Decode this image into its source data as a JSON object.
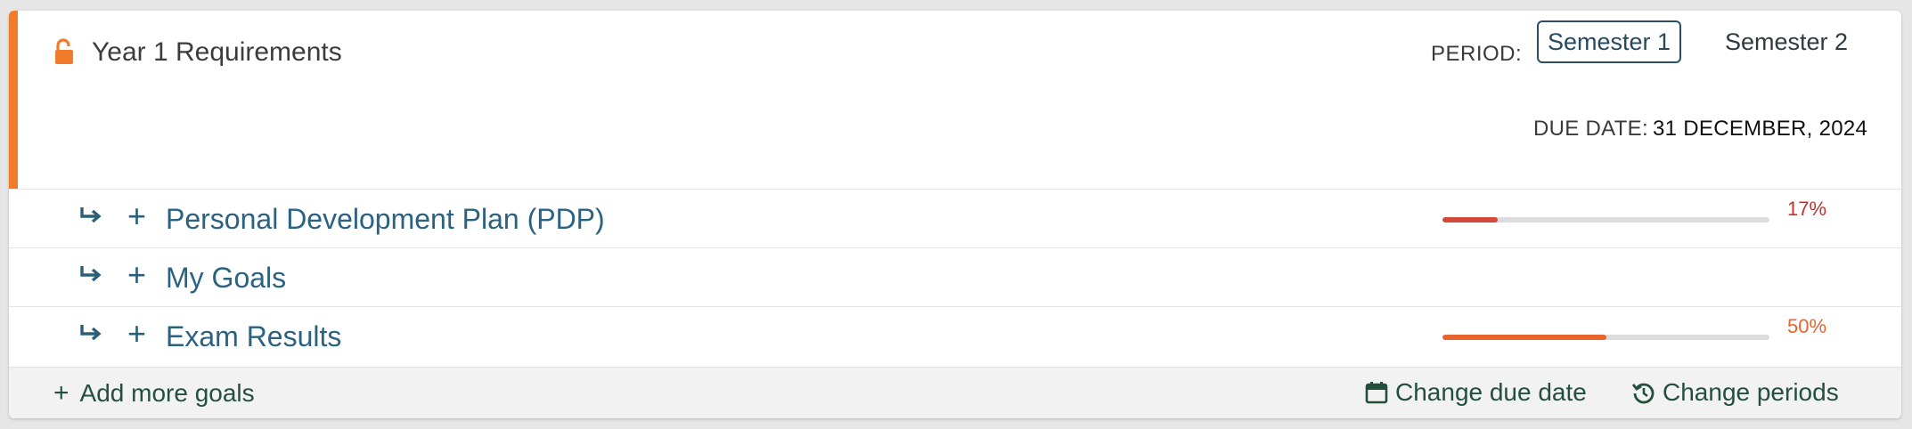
{
  "requirement": {
    "title": "Year 1 Requirements",
    "accent_color": "#f07b2b",
    "lock_icon": "unlocked-padlock-icon"
  },
  "period": {
    "label": "PERIOD:",
    "options": [
      "Semester 1",
      "Semester 2"
    ],
    "selected": "Semester 1"
  },
  "due_date": {
    "label": "DUE DATE:",
    "value": "31 DECEMBER, 2024"
  },
  "goals": [
    {
      "label": "Personal Development Plan (PDP)",
      "progress": 17,
      "progress_text": "17%",
      "color": "#d44a3a",
      "text_color": "#c0332a"
    },
    {
      "label": "My Goals"
    },
    {
      "label": "Exam Results",
      "progress": 50,
      "progress_text": "50%",
      "color": "#e8642e",
      "text_color": "#e8642e"
    }
  ],
  "footer": {
    "add_goals_icon": "+",
    "add_goals": "Add more goals",
    "change_due_date": "Change due date",
    "change_periods": "Change periods"
  }
}
